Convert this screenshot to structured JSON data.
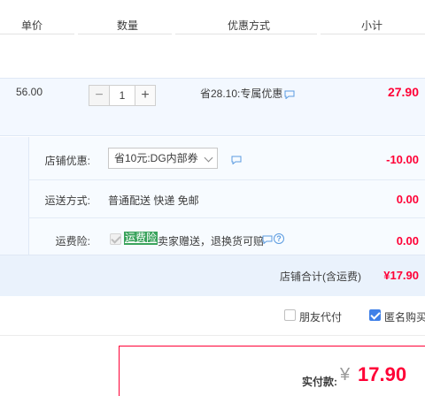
{
  "header": {
    "col_unit_price": "单价",
    "col_quantity": "数量",
    "col_discount": "优惠方式",
    "col_subtotal": "小计"
  },
  "item": {
    "unit_price": "56.00",
    "quantity": "1",
    "minus_label": "−",
    "plus_label": "+",
    "discount": "省28.10:专属优惠",
    "subtotal": "27.90"
  },
  "shop": {
    "coupon_label": "店铺优惠:",
    "coupon_selected": "省10元:DG内部券",
    "coupon_amount": "-10.00",
    "shipping_label": "运送方式:",
    "shipping_method": "普通配送 快递 免邮",
    "shipping_amount": "0.00",
    "insurance_label": "运费险:",
    "insurance_tag": "运费险",
    "insurance_desc": "卖家赠送，退换货可赔",
    "insurance_amount": "0.00",
    "total_label": "店铺合计(含运费)",
    "total_amount": "¥17.90"
  },
  "options": {
    "friend_pay_label": "朋友代付",
    "friend_pay_checked": false,
    "anonymous_label": "匿名购买",
    "anonymous_checked": true
  },
  "payment": {
    "label": "实付款:",
    "currency": "¥",
    "amount": "17.90"
  },
  "colors": {
    "price_red": "#ff0036",
    "accent_blue": "#3f80e8",
    "tag_green": "#3aa35c",
    "row_bg": "#f3f8ff"
  },
  "icons": [
    "chat-icon",
    "help-icon",
    "chevron-down-icon",
    "checkbox-icon"
  ]
}
